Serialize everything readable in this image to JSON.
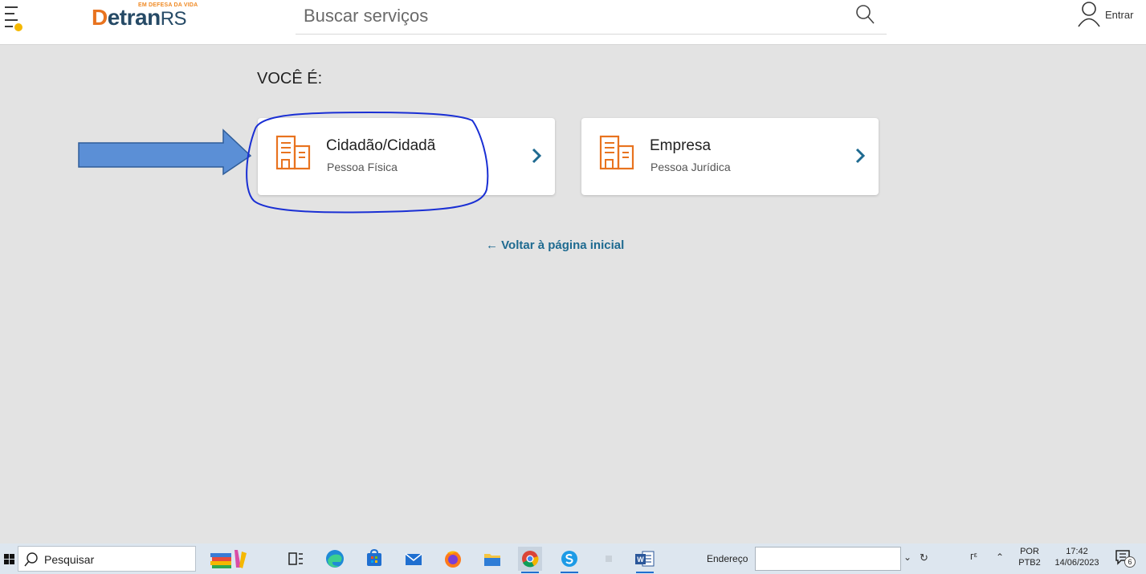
{
  "header": {
    "logo": {
      "tagline": "EM DEFESA DA VIDA",
      "word_d": "D",
      "word_etran": "etran",
      "word_rs": "RS"
    },
    "search": {
      "placeholder": "Buscar serviços"
    },
    "login_label": "Entrar",
    "icons": [
      "menu-icon",
      "search-icon",
      "user-icon"
    ]
  },
  "main": {
    "title": "VOCÊ É:",
    "cards": [
      {
        "title": "Cidadão/Cidadã",
        "subtitle": "Pessoa Física",
        "icon": "building-icon"
      },
      {
        "title": "Empresa",
        "subtitle": "Pessoa Jurídica",
        "icon": "building-icon"
      }
    ],
    "back_link": "← Voltar à página inicial"
  },
  "colors": {
    "accent_orange": "#e8731f",
    "brand_navy": "#264a66",
    "link_blue": "#1e6a90",
    "annotation_arrow": "#5b8fd6",
    "annotation_circle": "#1a2fd4"
  },
  "taskbar": {
    "search_label": "Pesquisar",
    "address_label": "Endereço",
    "lang_top": "POR",
    "lang_bottom": "PTB2",
    "time": "17:42",
    "date": "14/06/2023",
    "notification_count": "6",
    "apps": [
      "books-icon",
      "task-view-icon",
      "edge-icon",
      "store-icon",
      "mail-icon",
      "firefox-icon",
      "file-explorer-icon",
      "chrome-icon",
      "skype-icon",
      "word-icon"
    ]
  }
}
